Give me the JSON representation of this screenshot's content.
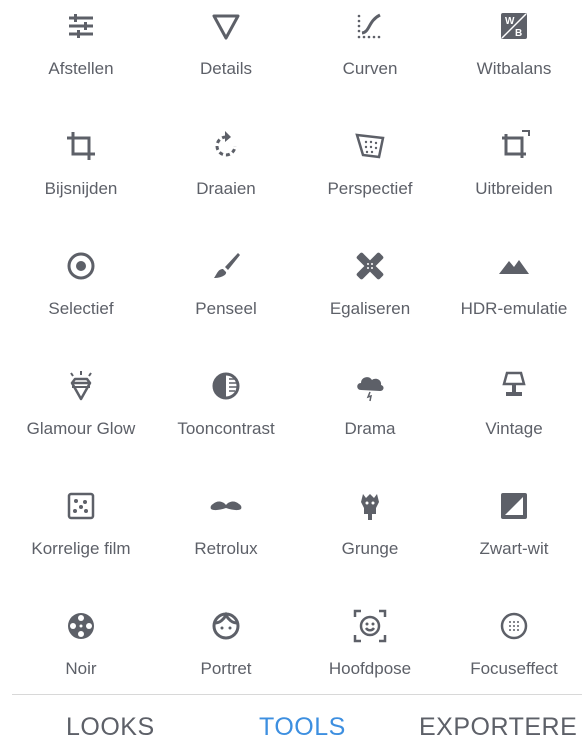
{
  "tools": [
    {
      "key": "afstellen",
      "label": "Afstellen",
      "icon": "sliders-icon"
    },
    {
      "key": "details",
      "label": "Details",
      "icon": "triangle-icon"
    },
    {
      "key": "curven",
      "label": "Curven",
      "icon": "curve-icon"
    },
    {
      "key": "witbalans",
      "label": "Witbalans",
      "icon": "white-balance-icon"
    },
    {
      "key": "bijsnijden",
      "label": "Bijsnijden",
      "icon": "crop-icon"
    },
    {
      "key": "draaien",
      "label": "Draaien",
      "icon": "rotate-icon"
    },
    {
      "key": "perspectief",
      "label": "Perspectief",
      "icon": "perspective-icon"
    },
    {
      "key": "uitbreiden",
      "label": "Uitbreiden",
      "icon": "expand-icon"
    },
    {
      "key": "selectief",
      "label": "Selectief",
      "icon": "selective-icon"
    },
    {
      "key": "penseel",
      "label": "Penseel",
      "icon": "brush-icon"
    },
    {
      "key": "egaliseren",
      "label": "Egaliseren",
      "icon": "healing-icon"
    },
    {
      "key": "hdr",
      "label": "HDR-emulatie",
      "icon": "mountains-icon"
    },
    {
      "key": "glamour",
      "label": "Glamour Glow",
      "icon": "diamond-icon"
    },
    {
      "key": "tooncontrast",
      "label": "Tooncontrast",
      "icon": "tonal-contrast-icon"
    },
    {
      "key": "drama",
      "label": "Drama",
      "icon": "cloud-icon"
    },
    {
      "key": "vintage",
      "label": "Vintage",
      "icon": "lamp-icon"
    },
    {
      "key": "korrelige",
      "label": "Korrelige film",
      "icon": "film-grain-icon"
    },
    {
      "key": "retrolux",
      "label": "Retrolux",
      "icon": "mustache-icon"
    },
    {
      "key": "grunge",
      "label": "Grunge",
      "icon": "grunge-icon"
    },
    {
      "key": "zwartwit",
      "label": "Zwart-wit",
      "icon": "black-white-icon"
    },
    {
      "key": "noir",
      "label": "Noir",
      "icon": "film-reel-icon"
    },
    {
      "key": "portret",
      "label": "Portret",
      "icon": "face-icon"
    },
    {
      "key": "hoofdpose",
      "label": "Hoofdpose",
      "icon": "head-pose-icon"
    },
    {
      "key": "focuseffect",
      "label": "Focuseffect",
      "icon": "focus-icon"
    }
  ],
  "tabs": {
    "looks": "LOOKS",
    "tools": "TOOLS",
    "export": "EXPORTERE"
  },
  "colors": {
    "icon": "#5d6068",
    "active_tab": "#3d8fe0",
    "inactive_tab": "#5d6068"
  }
}
